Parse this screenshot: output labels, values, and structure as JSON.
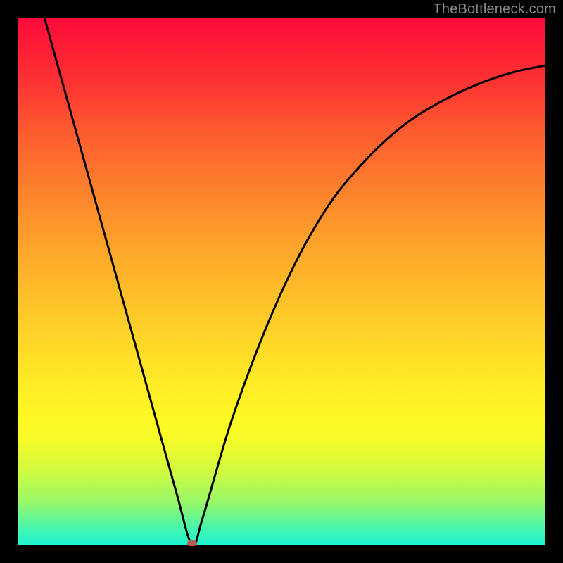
{
  "watermark": "TheBottleneck.com",
  "chart_data": {
    "type": "line",
    "title": "",
    "xlabel": "",
    "ylabel": "",
    "xlim": [
      0,
      100
    ],
    "ylim": [
      0,
      100
    ],
    "series": [
      {
        "name": "curve",
        "x": [
          5,
          10,
          15,
          20,
          25,
          30,
          33,
          35,
          40,
          45,
          50,
          55,
          60,
          65,
          70,
          75,
          80,
          85,
          90,
          95,
          100
        ],
        "values": [
          100,
          82,
          64,
          46,
          28,
          10,
          0,
          5,
          22,
          36,
          48,
          58,
          66,
          72,
          77,
          81,
          84,
          86.5,
          88.5,
          90,
          91
        ]
      }
    ],
    "marker": {
      "x": 33,
      "y": 0
    },
    "colors": {
      "curve": "#000000",
      "marker": "#ba5b52"
    }
  }
}
